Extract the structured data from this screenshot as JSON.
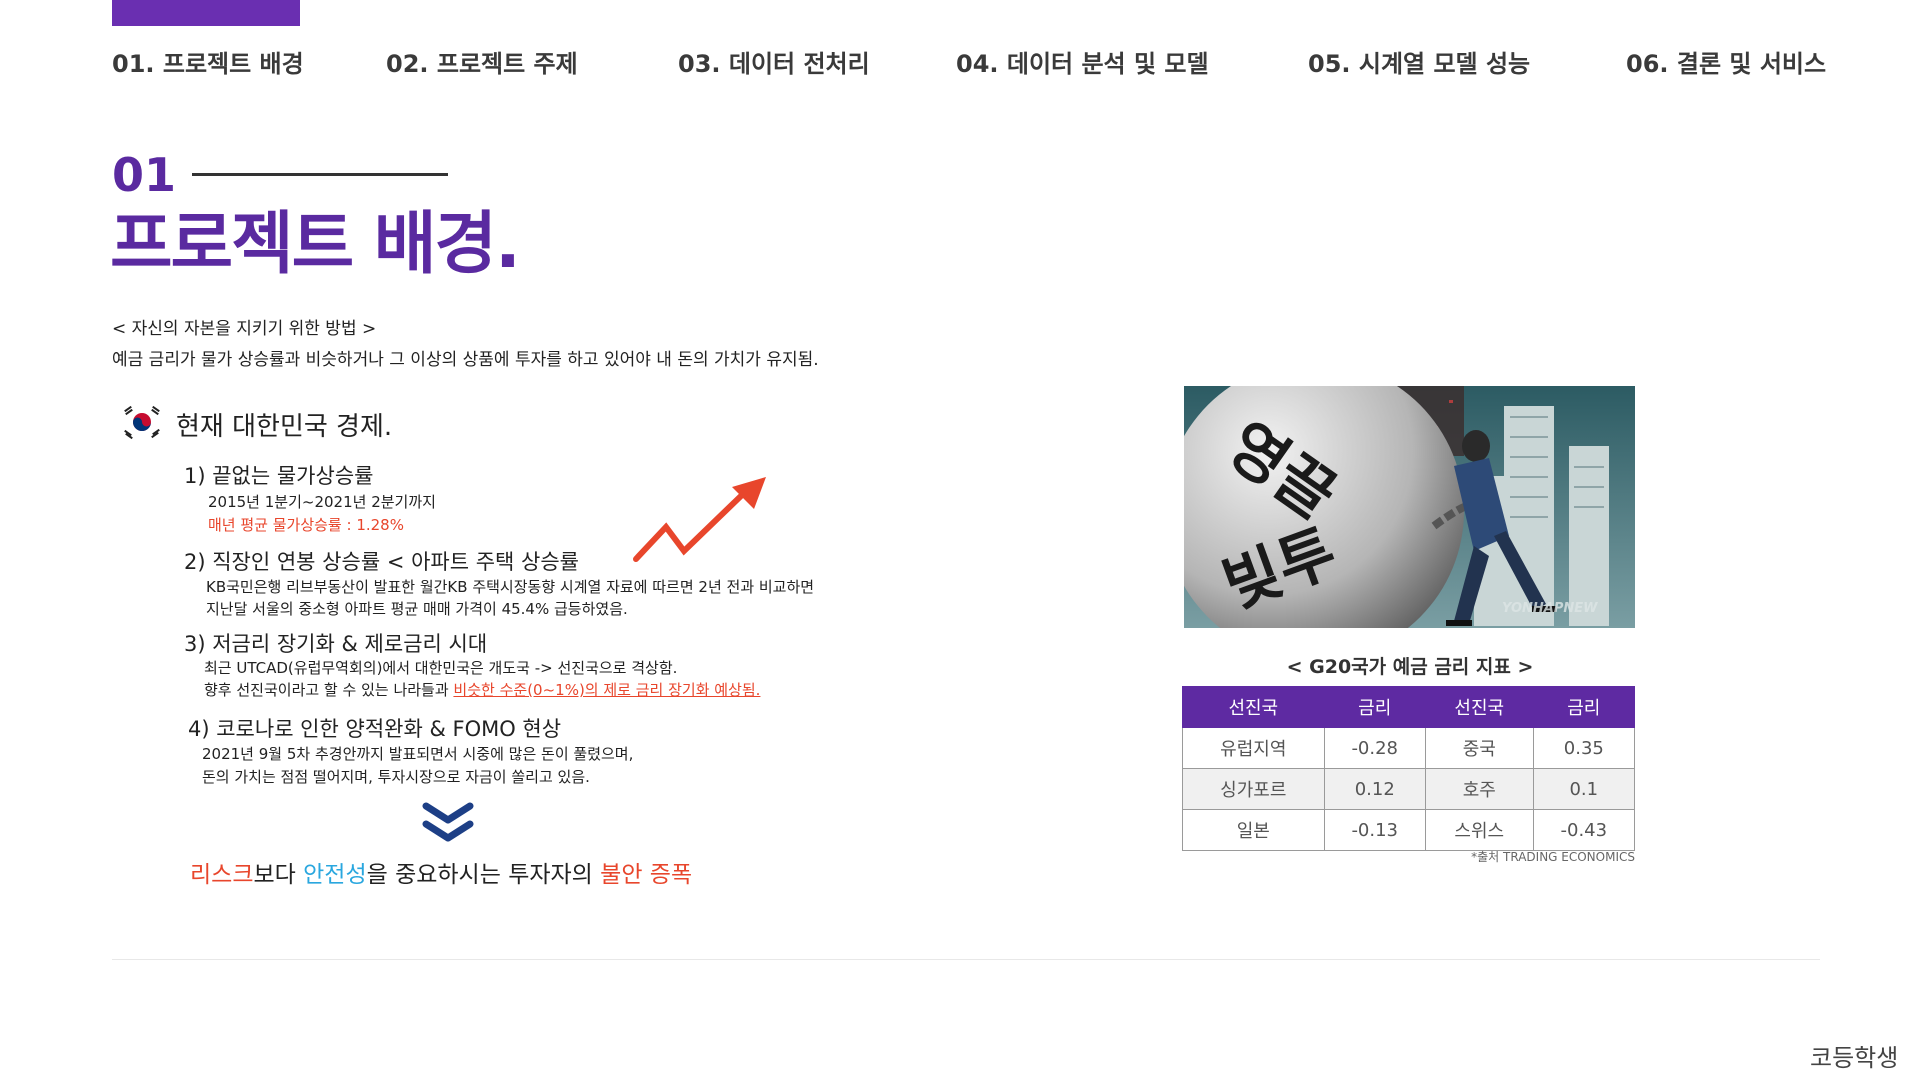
{
  "nav": {
    "items": [
      {
        "label": "01. 프로젝트 배경"
      },
      {
        "label": "02. 프로젝트 주제"
      },
      {
        "label": "03. 데이터 전처리"
      },
      {
        "label": "04. 데이터 분석 및 모델"
      },
      {
        "label": "05. 시계열 모델 성능"
      },
      {
        "label": "06. 결론 및 서비스"
      }
    ]
  },
  "section": {
    "number": "01",
    "title": "프로젝트 배경."
  },
  "intro": {
    "line1": "< 자신의 자본을 지키기 위한 방법 >",
    "line2": "예금 금리가 물가 상승률과 비슷하거나 그 이상의 상품에 투자를 하고 있어야 내 돈의 가치가 유지됨."
  },
  "korea": {
    "title": "현재 대한민국 경제.",
    "items": [
      {
        "title": "1) 끝없는 물가상승률",
        "lines": [
          "2015년 1분기~2021년 2분기까지",
          "매년 평균 물가상승률 : 1.28%"
        ]
      },
      {
        "title": "2) 직장인 연봉 상승률 < 아파트 주택 상승률",
        "lines": [
          "KB국민은행 리브부동산이 발표한 월간KB 주택시장동향 시계열 자료에 따르면 2년 전과 비교하면",
          "지난달 서울의 중소형 아파트 평균 매매 가격이 45.4% 급등하였음."
        ]
      },
      {
        "title": "3) 저금리 장기화 & 제로금리 시대",
        "lines": [
          "최근 UTCAD(유럽무역회의)에서 대한민국은 개도국 -> 선진국으로 격상함."
        ],
        "line2_prefix": "향후 선진국이라고 할 수 있는 나라들과 ",
        "line2_highlight": "비슷한 수준(0~1%)의 제로 금리 장기화 예상됨."
      },
      {
        "title": "4) 코로나로 인한 양적완화 & FOMO 현상",
        "lines": [
          "2021년 9월 5차 추경안까지 발표되면서 시중에 많은 돈이 풀렸으며,",
          "돈의 가치는 점점 떨어지며, 투자시장으로 자금이 쏠리고 있음."
        ]
      }
    ],
    "conclusion": {
      "part1": "리스크",
      "part2": "보다 ",
      "part3": "안전성",
      "part4": "을 중요하시는 투자자의 ",
      "part5": "불안 증폭"
    }
  },
  "image": {
    "ball_text1": "영끌",
    "ball_text2": "빚투",
    "watermark": "YONHAPNEW"
  },
  "rates": {
    "caption": "< G20국가 예금 금리 지표 >",
    "headers": [
      "선진국",
      "금리",
      "선진국",
      "금리"
    ],
    "rows": [
      [
        "유럽지역",
        "-0.28",
        "중국",
        "0.35"
      ],
      [
        "싱가포르",
        "0.12",
        "호주",
        "0.1"
      ],
      [
        "일본",
        "-0.13",
        "스위스",
        "-0.43"
      ]
    ],
    "source": "*출처 TRADING ECONOMICS"
  },
  "footer": {
    "brand": "코등학생"
  },
  "colors": {
    "accent": "#5e2aa2",
    "highlight": "#e8462c",
    "safe": "#2aa7df"
  }
}
